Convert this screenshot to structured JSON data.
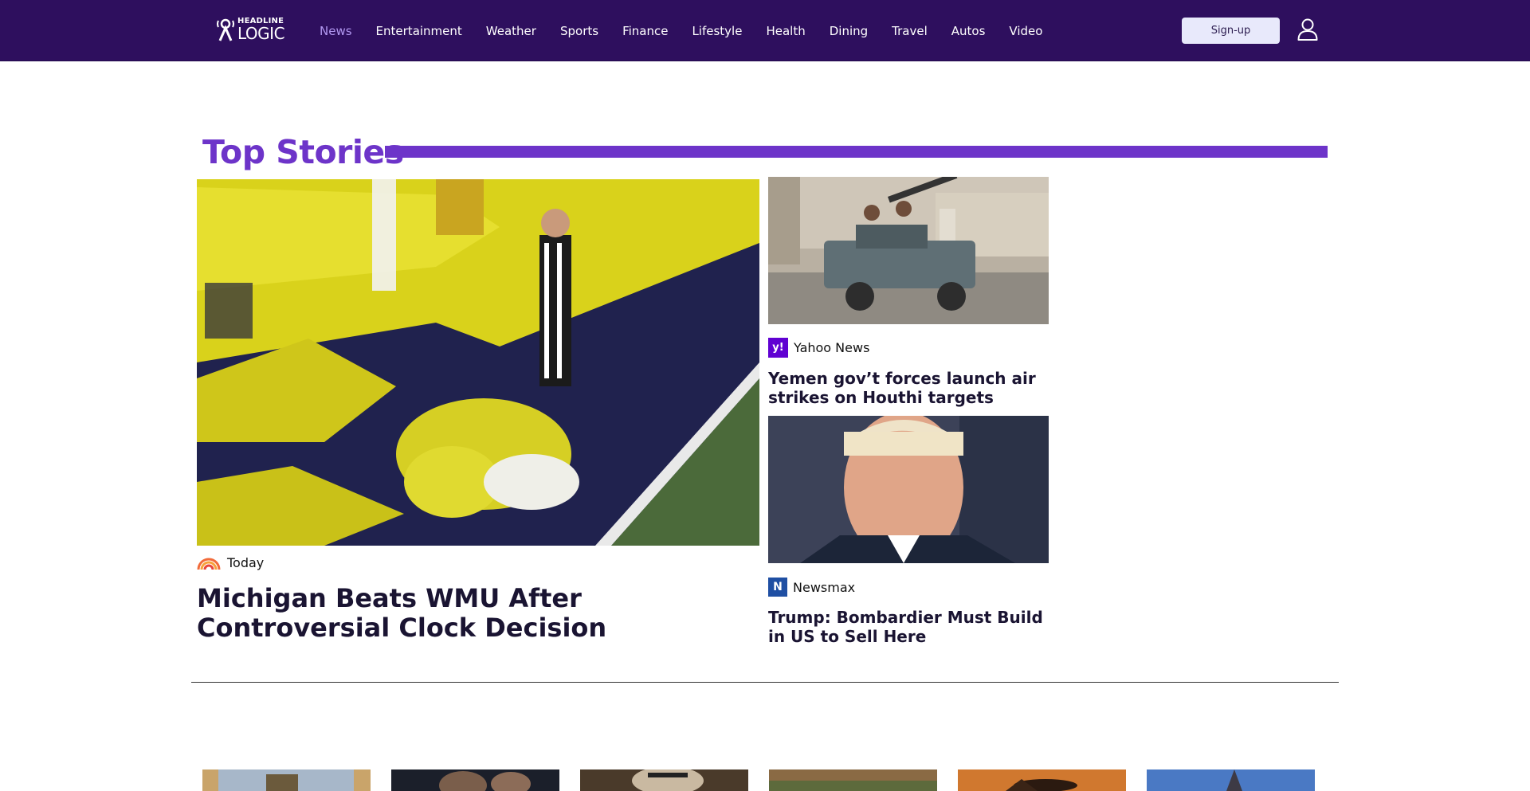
{
  "brand": {
    "line1": "HEADLINE",
    "line2": "LOGIC"
  },
  "nav": {
    "items": [
      {
        "label": "News"
      },
      {
        "label": "Entertainment"
      },
      {
        "label": "Weather"
      },
      {
        "label": "Sports"
      },
      {
        "label": "Finance"
      },
      {
        "label": "Lifestyle"
      },
      {
        "label": "Health"
      },
      {
        "label": "Dining"
      },
      {
        "label": "Travel"
      },
      {
        "label": "Autos"
      },
      {
        "label": "Video"
      }
    ],
    "active": "News"
  },
  "header": {
    "signup_label": "Sign-up",
    "user_icon": "user-icon"
  },
  "section": {
    "title": "Top Stories"
  },
  "hero": {
    "source": "Today",
    "title": "Michigan Beats WMU After Controversial Clock Decision"
  },
  "side": [
    {
      "source": "Yahoo News",
      "source_icon_letter": "y!",
      "title": "Yemen gov’t forces launch air strikes on Houthi targets"
    },
    {
      "source": "Newsmax",
      "source_icon_letter": "N",
      "title": "Trump: Bombardier Must Build in US to Sell Here"
    }
  ],
  "colors": {
    "header_bg": "#2e0f5e",
    "accent": "#6d34c9",
    "nav_active": "#b197f0",
    "headline": "#1a1432"
  }
}
